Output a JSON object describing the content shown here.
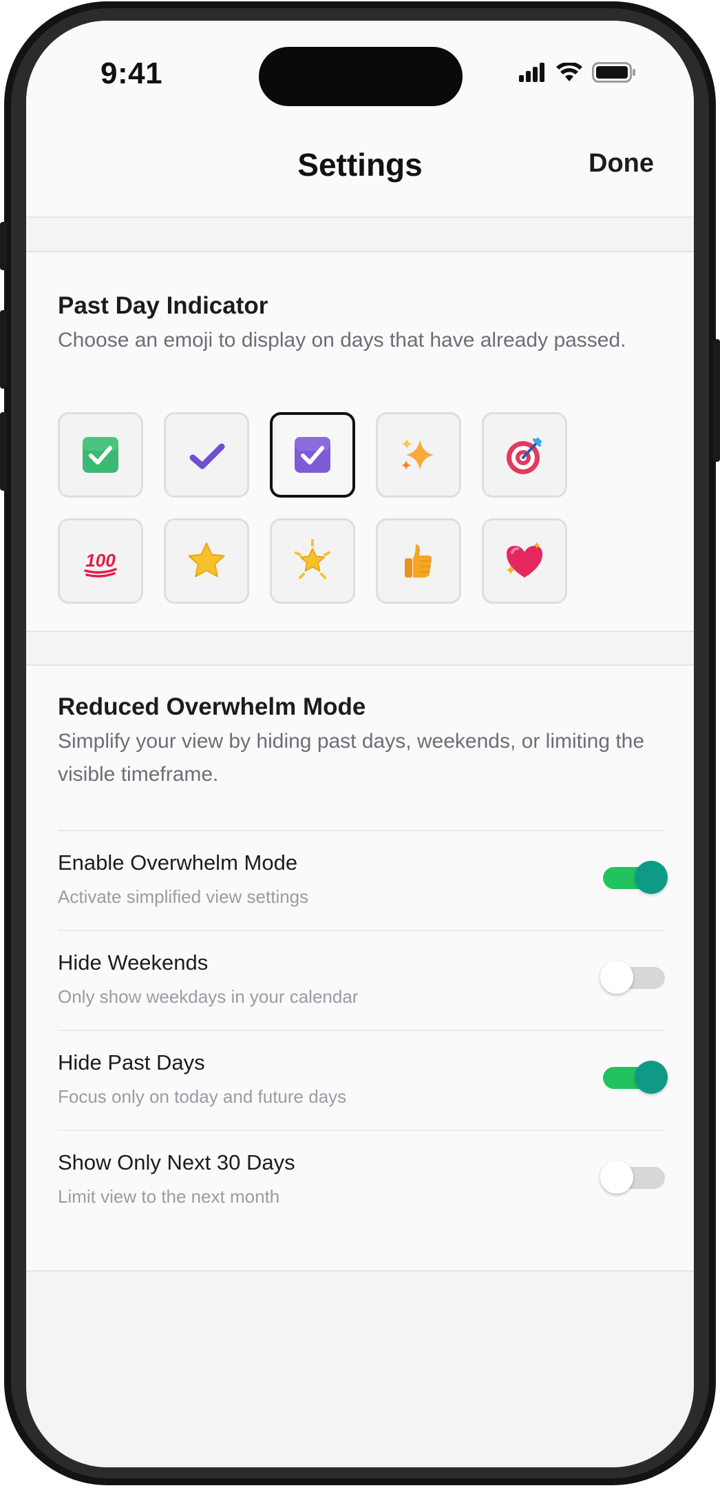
{
  "status_bar": {
    "time": "9:41"
  },
  "nav": {
    "title": "Settings",
    "done_label": "Done"
  },
  "past_day": {
    "title": "Past Day Indicator",
    "description": "Choose an emoji to display on days that have already passed.",
    "selected_index": 2,
    "emojis": [
      {
        "icon": "green-check-box-icon"
      },
      {
        "icon": "purple-check-mark-icon"
      },
      {
        "icon": "purple-check-box-icon"
      },
      {
        "icon": "sparkles-icon"
      },
      {
        "icon": "bullseye-target-icon"
      },
      {
        "icon": "hundred-points-icon",
        "text": "100"
      },
      {
        "icon": "star-icon"
      },
      {
        "icon": "glowing-star-icon"
      },
      {
        "icon": "thumbs-up-icon"
      },
      {
        "icon": "sparkling-heart-icon"
      }
    ]
  },
  "overwhelm": {
    "title": "Reduced Overwhelm Mode",
    "description": "Simplify your view by hiding past days, weekends, or limiting the visible timeframe.",
    "settings": [
      {
        "label": "Enable Overwhelm Mode",
        "sub": "Activate simplified view settings",
        "on": true
      },
      {
        "label": "Hide Weekends",
        "sub": "Only show weekdays in your calendar",
        "on": false
      },
      {
        "label": "Hide Past Days",
        "sub": "Focus only on today and future days",
        "on": true
      },
      {
        "label": "Show Only Next 30 Days",
        "sub": "Limit view to the next month",
        "on": false
      }
    ]
  },
  "colors": {
    "toggle_on_track": "#22c35e",
    "toggle_on_knob": "#0e9a84",
    "toggle_off_track": "#d7d7da"
  }
}
